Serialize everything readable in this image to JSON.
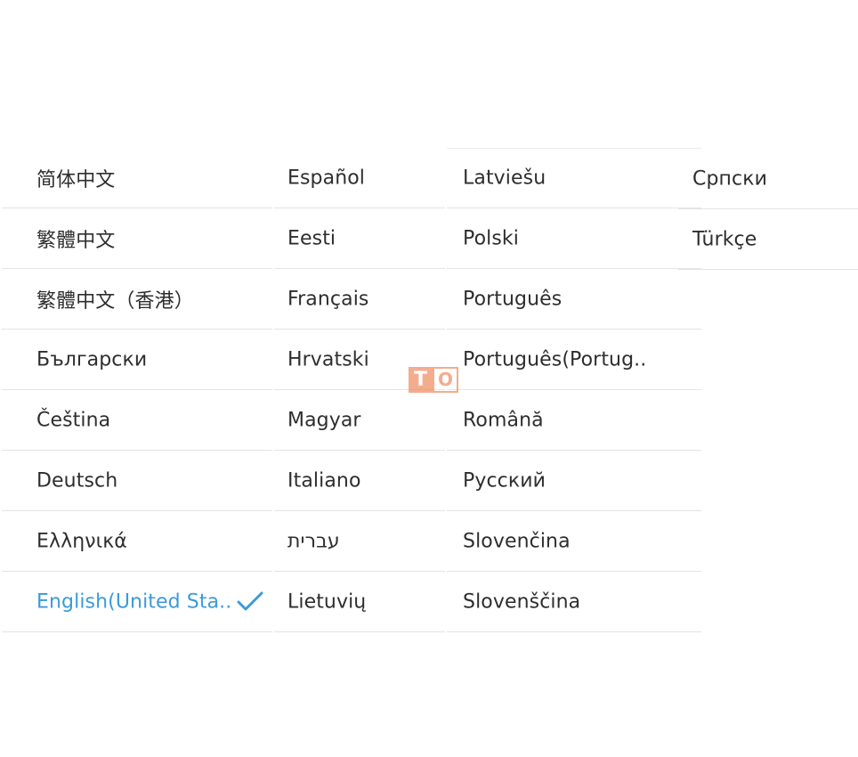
{
  "languages": {
    "column1": [
      {
        "label": "简体中文"
      },
      {
        "label": "繁體中文"
      },
      {
        "label": "繁體中文（香港）"
      },
      {
        "label": "Български"
      },
      {
        "label": "Čeština"
      },
      {
        "label": "Deutsch"
      },
      {
        "label": "Ελληνικά"
      },
      {
        "label": "English(United Sta..",
        "selected": true,
        "icon": "checkmark-icon"
      }
    ],
    "column2": [
      {
        "label": "Español"
      },
      {
        "label": "Eesti"
      },
      {
        "label": "Français"
      },
      {
        "label": "Hrvatski"
      },
      {
        "label": "Magyar"
      },
      {
        "label": "Italiano"
      },
      {
        "label": "עברית"
      },
      {
        "label": "Lietuvių"
      }
    ],
    "column3": [
      {
        "label": "Latviešu"
      },
      {
        "label": "Polski"
      },
      {
        "label": "Português"
      },
      {
        "label": "Português(Portug.."
      },
      {
        "label": "Română"
      },
      {
        "label": "Русский"
      },
      {
        "label": "Slovenčina"
      },
      {
        "label": "Slovenščina"
      }
    ],
    "column4": [
      {
        "label": "Српски"
      },
      {
        "label": "Türkçe"
      }
    ]
  },
  "watermark": {
    "letter1": "T",
    "letter2": "O"
  },
  "colors": {
    "selected_text": "#3c9ad9",
    "divider": "#e4e4e4",
    "watermark": "#f08a5f"
  }
}
